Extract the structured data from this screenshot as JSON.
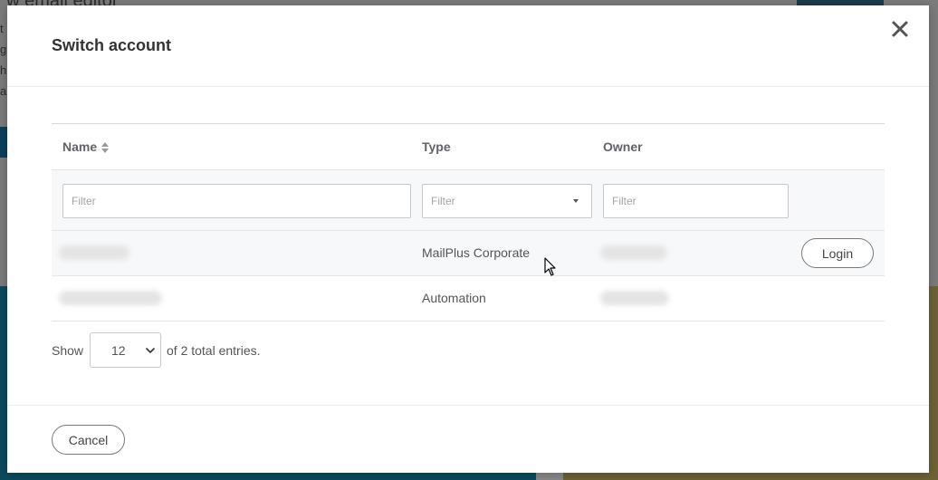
{
  "background": {
    "title_fragment": "ew email editor",
    "side_text_fragments": [
      "t",
      "g",
      "h",
      "a"
    ],
    "partial_letter": "l"
  },
  "modal": {
    "title": "Switch account",
    "close_icon": "close-x-icon"
  },
  "table": {
    "columns": [
      {
        "label": "Name",
        "sortable": true
      },
      {
        "label": "Type"
      },
      {
        "label": "Owner"
      }
    ],
    "filters": {
      "name_placeholder": "Filter",
      "type_placeholder": "Filter",
      "owner_placeholder": "Filter"
    },
    "rows": [
      {
        "name": "",
        "type": "MailPlus Corporate",
        "owner": "",
        "action": "Login",
        "highlighted": true
      },
      {
        "name": "",
        "type": "Automation",
        "owner": "",
        "action": "",
        "highlighted": false
      }
    ]
  },
  "pagination": {
    "show_label": "Show",
    "page_size": "12",
    "total_text": "of 2 total entries."
  },
  "footer": {
    "cancel_label": "Cancel"
  },
  "colors": {
    "overlay": "#7a7a7a",
    "modal_bg": "#ffffff",
    "row_highlight": "#f7f8fa",
    "border": "#e5e5e5",
    "text": "#333333"
  }
}
